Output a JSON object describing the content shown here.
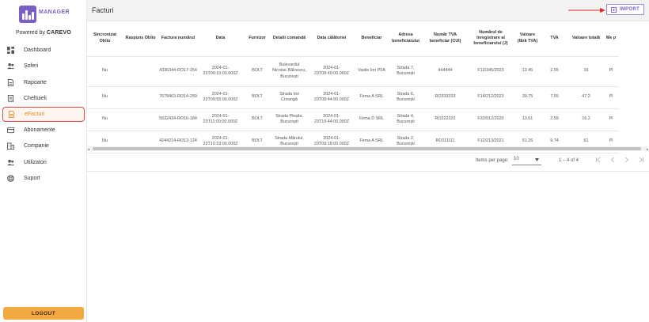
{
  "logo": {
    "text": "MANAGER"
  },
  "powered": {
    "prefix": "Powered by",
    "brand": "CAREVO"
  },
  "sidebar": {
    "items": [
      {
        "label": "Dashboard",
        "icon": "dashboard-icon"
      },
      {
        "label": "Șoferi",
        "icon": "people-icon"
      },
      {
        "label": "Rapoarte",
        "icon": "report-icon"
      },
      {
        "label": "Cheltuieli",
        "icon": "receipt-icon"
      },
      {
        "label": "eFacturi",
        "icon": "invoice-icon",
        "active": true
      },
      {
        "label": "Abonamente",
        "icon": "subscription-icon"
      },
      {
        "label": "Companie",
        "icon": "company-icon"
      },
      {
        "label": "Utilizatori",
        "icon": "users-icon"
      },
      {
        "label": "Suport",
        "icon": "support-icon"
      }
    ],
    "logout_label": "LOGOUT"
  },
  "header": {
    "title": "Facturi",
    "import_label": "IMPORT"
  },
  "table": {
    "columns": [
      "Sincronizat Oblio",
      "Raspuns Oblio",
      "Factura numărul",
      "Data",
      "Furnizor",
      "Detalii comandă",
      "Data călătoriei",
      "Beneficiar",
      "Adresa beneficiarului",
      "Număr TVA beneficiar (CUI)",
      "Numărul de înregistrare al beneficiarului (J)",
      "Valoare (fără TVA)",
      "TVA",
      "Valoare totală",
      "Me p"
    ],
    "rows": [
      [
        "Nu",
        "",
        "4336344-RO17-154",
        "2024-01-23T09:15:00.000Z",
        "BOLT",
        "Bulevardul Nicolae Bălcescu, București",
        "2024-01-23T08:49:00.000Z",
        "Vasile Ion PFA",
        "Strada 7, București",
        "444444",
        "F12/345/2023",
        "13.45",
        "2.55",
        "16",
        "Pl"
      ],
      [
        "Nu",
        "",
        "7678463-RO14-259",
        "2024-01-23T09:55:00.000Z",
        "BOLT",
        "Strada Ion Creangă",
        "2024-01-23T08:44:00.000Z",
        "Firma A SRL",
        "Strada 6, București",
        "RO333333",
        "F14/212/2023",
        "39.75",
        "7.55",
        "47.2",
        "Pl"
      ],
      [
        "Nu",
        "",
        "5532434-RO16-184",
        "2024-01-23T11:09:00.000Z",
        "BOLT",
        "Strada Pleșila, București",
        "2024-01-23T10:44:00.000Z",
        "Firma D SRL",
        "Strada 4, București",
        "RO222222",
        "F32/012/2020",
        "13.61",
        "2.59",
        "16.2",
        "Pl"
      ],
      [
        "Nu",
        "",
        "4244214-RO12-124",
        "2024-01-23T10:19:00.000Z",
        "BOLT",
        "Strada Mărului, București",
        "2024-01-23T09:18:00.000Z",
        "Firma A SRL",
        "Strada 2, București",
        "RO111111",
        "F12/213/2021",
        "51.26",
        "9.74",
        "61",
        "Pl"
      ]
    ]
  },
  "pagination": {
    "rows_per_page_label": "Items per page:",
    "rows_per_page": "10",
    "range": "1 – 4 of 4"
  },
  "colors": {
    "accent": "#7a5ec6",
    "logout": "#f3a93f",
    "active_border": "#d94646",
    "active_text": "#e08a2a",
    "arrow": "#d32f2f"
  }
}
